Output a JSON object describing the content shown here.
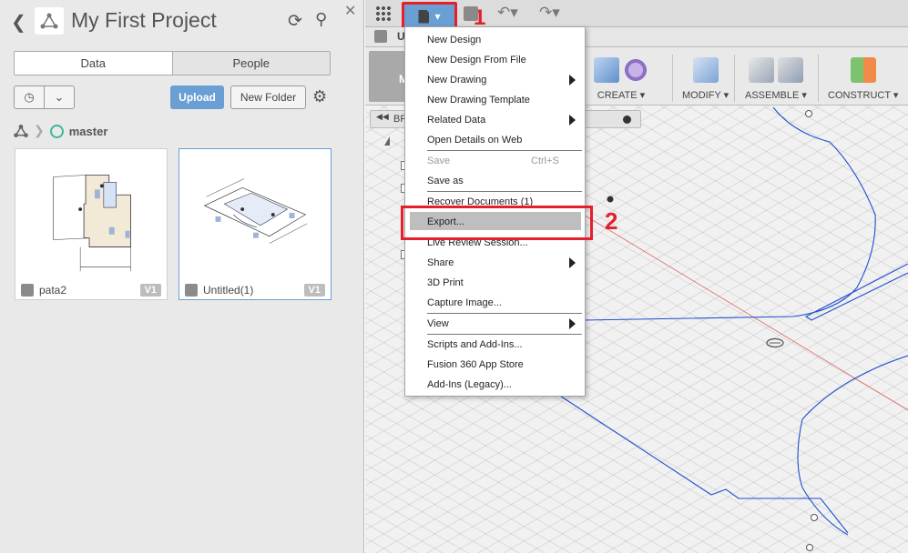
{
  "data_panel": {
    "title": "My First Project",
    "tabs": [
      "Data",
      "People"
    ],
    "upload_label": "Upload",
    "new_folder_label": "New Folder",
    "breadcrumb_branch": "master",
    "files": [
      {
        "name": "pata2",
        "version": "V1"
      },
      {
        "name": "Untitled(1)",
        "version": "V1"
      }
    ]
  },
  "workspace": {
    "doc_tab": "U",
    "mode_letter": "M",
    "toolbar_groups": [
      "CREATE ▾",
      "MODIFY ▾",
      "ASSEMBLE ▾",
      "CONSTRUCT ▾"
    ],
    "browser_label": "BR",
    "accent_color": "#6a9fd4",
    "sketch_color": "#1f4fcf"
  },
  "file_menu": {
    "items": [
      {
        "label": "New Design"
      },
      {
        "label": "New Design From File"
      },
      {
        "label": "New Drawing"
      },
      {
        "label": "New Drawing Template"
      },
      {
        "label": "Related Data"
      },
      {
        "label": "Open Details on Web"
      },
      {
        "label": "Save",
        "shortcut": "Ctrl+S"
      },
      {
        "label": "Save as"
      },
      {
        "label": "Recover Documents (1)"
      },
      {
        "label": "Export..."
      },
      {
        "label": "Live Review Session..."
      },
      {
        "label": "Share"
      },
      {
        "label": "3D Print"
      },
      {
        "label": "Capture Image..."
      },
      {
        "label": "View"
      },
      {
        "label": "Scripts and Add-Ins..."
      },
      {
        "label": "Fusion 360 App Store"
      },
      {
        "label": "Add-Ins (Legacy)..."
      }
    ]
  },
  "annotations": {
    "step1": "1",
    "step2": "2",
    "color": "#e4212b"
  }
}
